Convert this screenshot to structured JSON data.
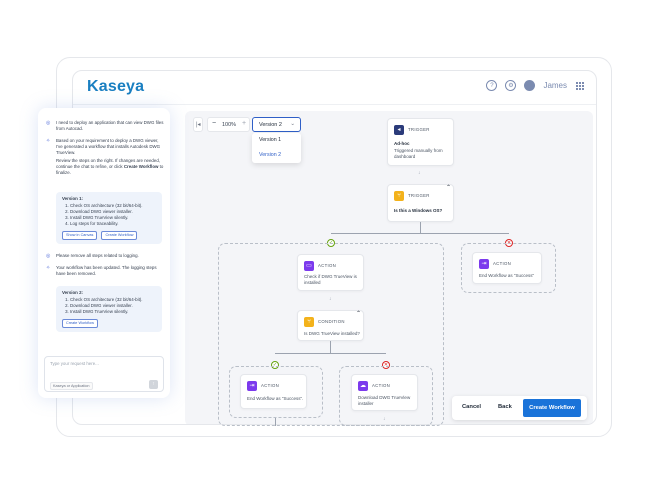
{
  "header": {
    "logo": "Kaseya",
    "user_name": "James"
  },
  "toolbar": {
    "zoom": "100%",
    "selected_version": "Version 2",
    "version_options": [
      "Version 1",
      "Version 2"
    ]
  },
  "chat": {
    "messages": [
      {
        "role": "user",
        "text": "I need to deploy an application that can view DWG files from Autocad."
      },
      {
        "role": "assistant",
        "text": "Based on your requirement to deploy a DWG viewer, I've generated a workflow that installs Autodesk DWG TrueView.",
        "text2": "Review the steps on the right. If changes are needed, continue the chat to refine, or click",
        "text2_bold": "Create Workflow",
        "text2_end": " to finalize."
      },
      {
        "role": "user",
        "text": "Please remove all steps related to logging."
      },
      {
        "role": "assistant",
        "text": "Your workflow has been updated. The logging steps have been removed."
      }
    ],
    "version1": {
      "title": "Version 1:",
      "steps": [
        "Check OS architecture (32 bit/64-bit).",
        "Download DWG viewer installer.",
        "Install DWG TrueView silently.",
        "Log steps for traceability."
      ],
      "show_canvas": "Show in Canvas",
      "create_workflow": "Create Workflow"
    },
    "version2": {
      "title": "Version 2:",
      "steps": [
        "Check OS architecture (32 bit/64-bit).",
        "Download DWG viewer installer.",
        "Install DWG TrueView silently."
      ],
      "create_workflow": "Create Workflow"
    },
    "input_placeholder": "Type your request here...",
    "attach_label": "Kaseya or Application"
  },
  "nodes": {
    "trigger1": {
      "type": "TRIGGER",
      "title": "Ad-hoc",
      "desc": "Triggered manually from dashboard"
    },
    "trigger2": {
      "type": "TRIGGER",
      "title": "Is this a Windows OS?"
    },
    "action_check": {
      "type": "ACTION",
      "desc": "Check if DWG TrueView is installed"
    },
    "action_end_success_right": {
      "type": "ACTION",
      "desc": "End Workflow as \"Success\""
    },
    "condition": {
      "type": "CONDITION",
      "desc": "Is DWG TrueView installed?"
    },
    "action_end_success_left": {
      "type": "ACTION",
      "desc": "End Workflow as \"Success\"."
    },
    "action_download": {
      "type": "ACTION",
      "desc": "Download DWG TrueView installer"
    }
  },
  "footer": {
    "cancel": "Cancel",
    "back": "Back",
    "create": "Create Workflow"
  },
  "colors": {
    "brand": "#1a7fc1",
    "primary_button": "#1a73d9",
    "trigger_icon": "#2b3b7a",
    "condition_icon": "#f3b21b",
    "action_icon": "#7c3aed",
    "success": "#65a30d",
    "failure": "#dc2626"
  }
}
